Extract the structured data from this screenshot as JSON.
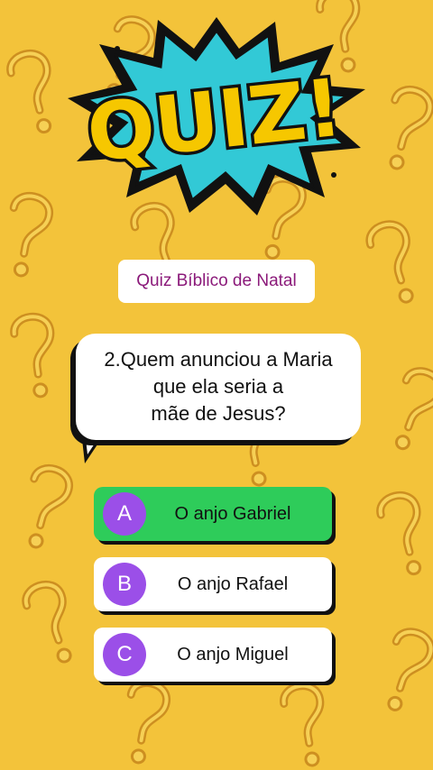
{
  "header": {
    "logo_text": "QUIZ!",
    "subtitle": "Quiz Bíblico de Natal"
  },
  "question": {
    "line1": "2.Quem anunciou a Maria",
    "line2": "que ela seria a",
    "line3": "mãe de Jesus?"
  },
  "options": [
    {
      "letter": "A",
      "text": "O anjo Gabriel",
      "state": "correct"
    },
    {
      "letter": "B",
      "text": "O anjo Rafael",
      "state": "normal"
    },
    {
      "letter": "C",
      "text": "O anjo Miguel",
      "state": "normal"
    }
  ],
  "colors": {
    "background": "#f3c33a",
    "correct": "#2ecc5a",
    "letter_circle": "#9b4fe8",
    "subtitle_text": "#8b1a7a",
    "logo_yellow": "#f6c700",
    "logo_burst": "#32c9d6"
  }
}
